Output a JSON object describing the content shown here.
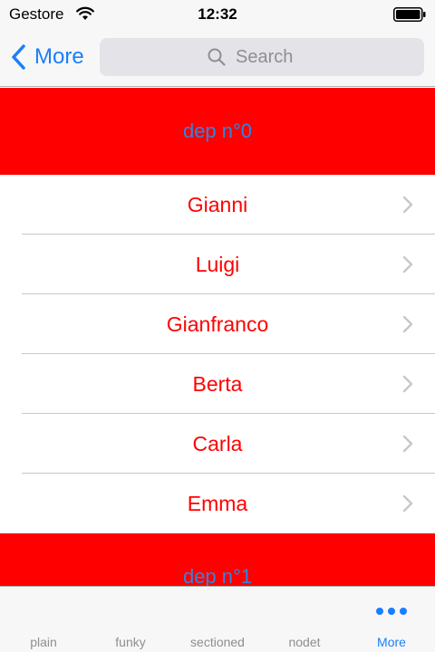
{
  "status_bar": {
    "carrier": "Gestore",
    "time": "12:32"
  },
  "nav": {
    "back_label": "More",
    "search_placeholder": "Search"
  },
  "sections": [
    {
      "header": "dep n°0",
      "rows": [
        "Gianni",
        "Luigi",
        "Gianfranco",
        "Berta",
        "Carla",
        "Emma"
      ]
    },
    {
      "header": "dep n°1",
      "rows": []
    }
  ],
  "tabs": [
    {
      "label": "plain",
      "active": false
    },
    {
      "label": "funky",
      "active": false
    },
    {
      "label": "sectioned",
      "active": false
    },
    {
      "label": "nodet",
      "active": false
    },
    {
      "label": "More",
      "active": true,
      "icon": "more-icon"
    }
  ],
  "colors": {
    "accent": "#1a7ffb",
    "section_bg": "#ff0000",
    "row_text": "#ff0000",
    "header_text": "#2e86e0"
  }
}
